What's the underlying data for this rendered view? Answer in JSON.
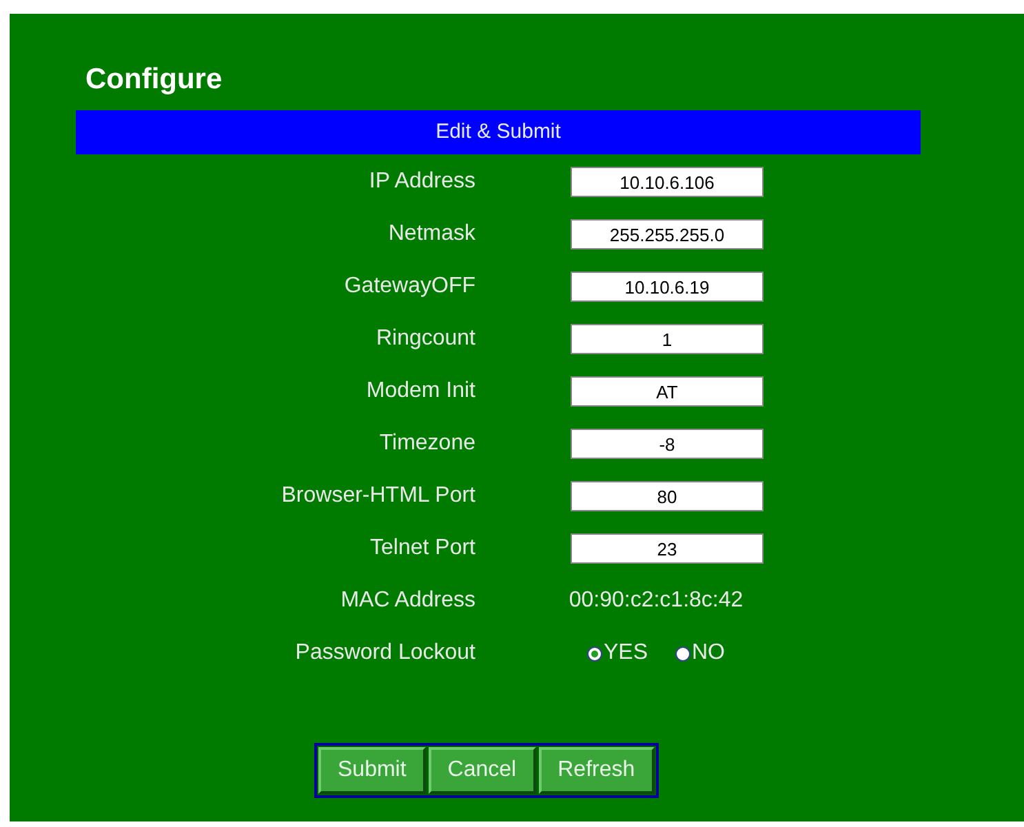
{
  "title": "Configure",
  "header": "Edit & Submit",
  "fields": [
    {
      "kind": "input",
      "label": "IP Address",
      "value": "10.10.6.106"
    },
    {
      "kind": "input",
      "label": "Netmask",
      "value": "255.255.255.0"
    },
    {
      "kind": "input",
      "label": "GatewayOFF",
      "value": "10.10.6.19"
    },
    {
      "kind": "input",
      "label": "Ringcount",
      "value": "1"
    },
    {
      "kind": "input",
      "label": "Modem Init",
      "value": "AT"
    },
    {
      "kind": "input",
      "label": "Timezone",
      "value": "-8"
    },
    {
      "kind": "input",
      "label": "Browser-HTML Port",
      "value": "80"
    },
    {
      "kind": "input",
      "label": "Telnet Port",
      "value": "23"
    },
    {
      "kind": "text",
      "label": "MAC Address",
      "value": "00:90:c2:c1:8c:42"
    },
    {
      "kind": "radio",
      "label": "Password Lockout",
      "options": [
        {
          "label": "YES",
          "selected": true
        },
        {
          "label": "NO",
          "selected": false
        }
      ]
    }
  ],
  "buttons": [
    "Submit",
    "Cancel",
    "Refresh"
  ]
}
